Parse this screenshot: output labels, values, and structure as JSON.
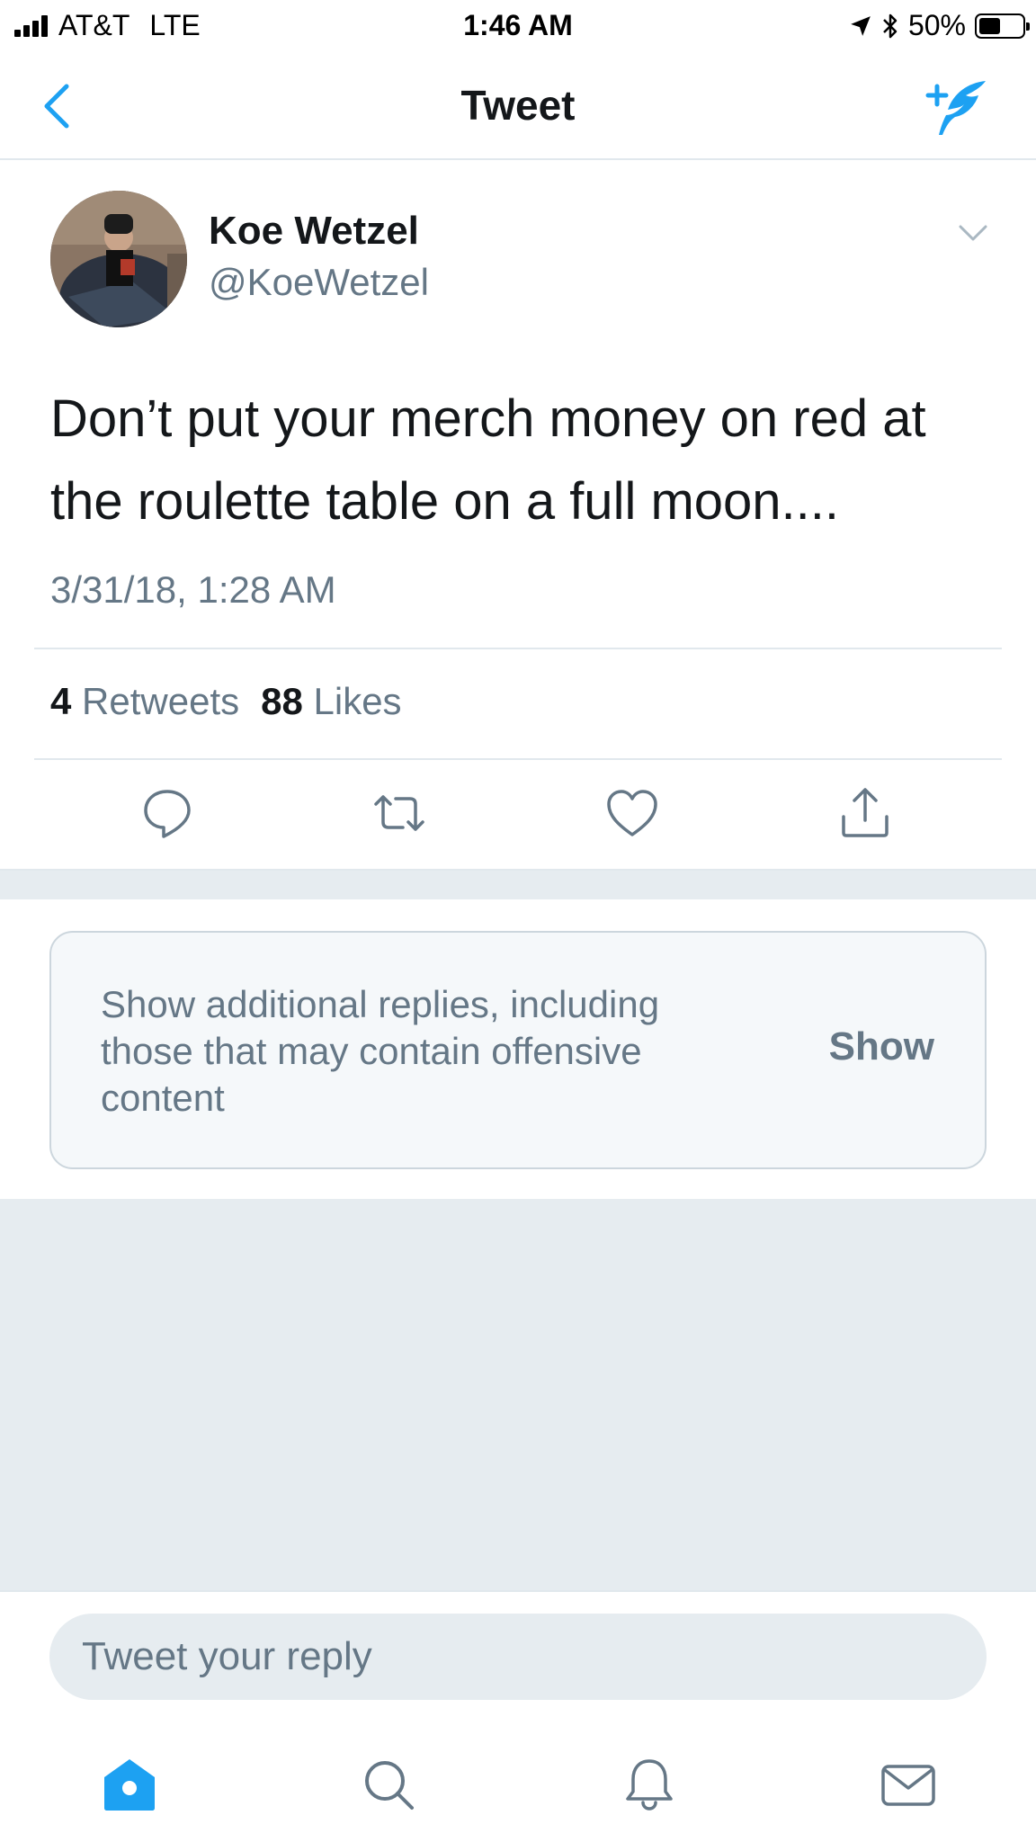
{
  "status_bar": {
    "carrier": "AT&T",
    "network": "LTE",
    "time": "1:46 AM",
    "battery": "50%",
    "battery_level": 0.5
  },
  "nav": {
    "title": "Tweet",
    "back_icon": "chevron-left-icon",
    "compose_icon": "compose-tweet-icon"
  },
  "tweet": {
    "author_name": "Koe Wetzel",
    "author_handle": "@KoeWetzel",
    "text": "Don’t put your merch money on red at the roulette table on a full moon....",
    "timestamp": "3/31/18, 1:28 AM",
    "retweets_count": "4",
    "retweets_label": "Retweets",
    "likes_count": "88",
    "likes_label": "Likes"
  },
  "actions": [
    "reply-icon",
    "retweet-icon",
    "like-icon",
    "share-icon"
  ],
  "additional_replies": {
    "message": "Show additional replies, including those that may contain offensive content",
    "button_label": "Show"
  },
  "reply_box": {
    "placeholder": "Tweet your reply"
  },
  "tab_bar": {
    "tabs": [
      "home-icon",
      "search-icon",
      "notifications-icon",
      "messages-icon"
    ],
    "active": "home-icon"
  },
  "colors": {
    "accent": "#1da1f2",
    "text_primary": "#14171a",
    "text_secondary": "#657786",
    "divider": "#e1e8ed",
    "gray_background": "#e6ecf0",
    "icon_gray": "#657786"
  }
}
